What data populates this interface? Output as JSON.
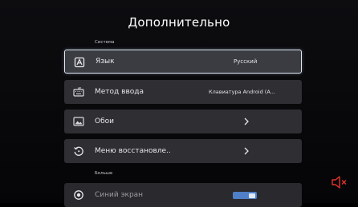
{
  "page": {
    "title": "Дополнительно"
  },
  "sections": {
    "system": "Система",
    "more": "Больше"
  },
  "rows": [
    {
      "label": "Язык",
      "value": "Русский",
      "icon": "language-icon",
      "focused": true
    },
    {
      "label": "Метод ввода",
      "value": "Клавиатура Android (A...",
      "icon": "keyboard-icon"
    },
    {
      "label": "Обои",
      "value": "",
      "icon": "wallpaper-icon",
      "chevron": true
    },
    {
      "label": "Меню восстановле..",
      "value": "",
      "icon": "restore-icon",
      "chevron": true
    },
    {
      "label": "Синий экран",
      "value": "",
      "icon": "blue-screen-icon",
      "toggle": true,
      "toggle_on": true
    }
  ],
  "colors": {
    "accent": "#4e7fc8",
    "mute_icon": "#e0352b"
  },
  "icons": {
    "mute": "mute-speaker-icon",
    "chevron": "chevron-right-icon"
  }
}
